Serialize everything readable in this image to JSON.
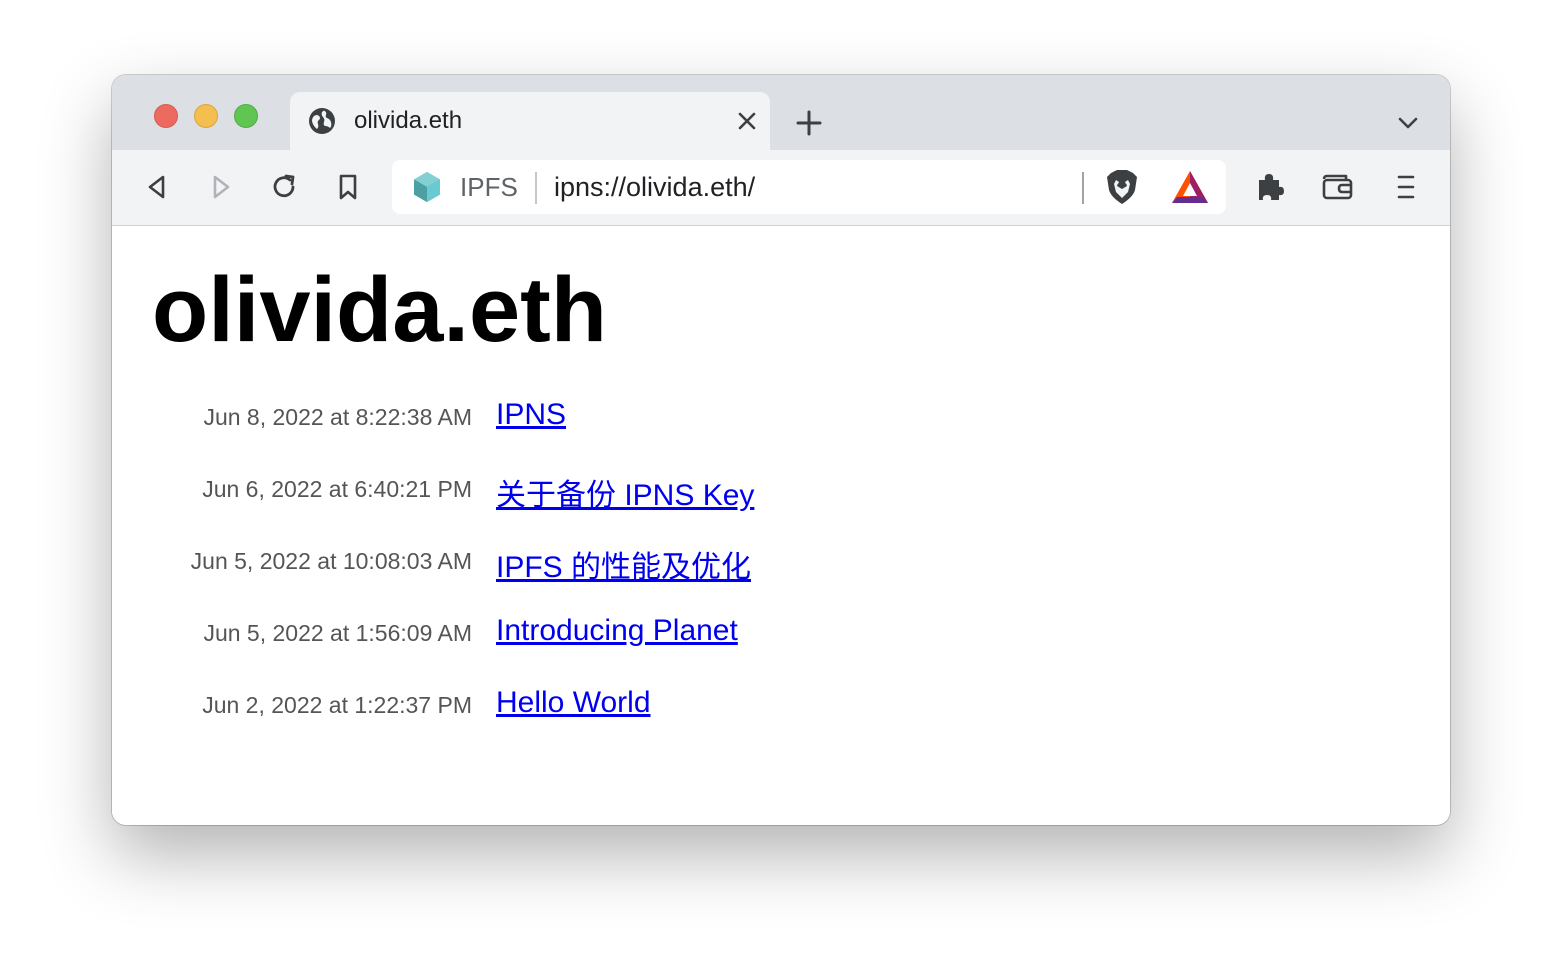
{
  "browser": {
    "tab": {
      "title": "olivida.eth",
      "icon": "globe-icon"
    },
    "address_bar": {
      "badge_label": "IPFS",
      "url": "ipns://olivida.eth/"
    },
    "icons": {
      "back": "back-arrow-icon",
      "forward": "forward-arrow-icon",
      "reload": "reload-icon",
      "bookmark": "bookmark-icon",
      "ipfs": "ipfs-cube-icon",
      "shields": "brave-shields-icon",
      "rewards": "brave-rewards-icon",
      "extensions": "puzzle-piece-icon",
      "wallet": "wallet-icon",
      "menu": "hamburger-menu-icon"
    }
  },
  "page": {
    "title": "olivida.eth",
    "posts": [
      {
        "date": "Jun 8, 2022 at 8:22:38 AM",
        "title": "IPNS"
      },
      {
        "date": "Jun 6, 2022 at 6:40:21 PM",
        "title": "关于备份 IPNS Key"
      },
      {
        "date": "Jun 5, 2022 at 10:08:03 AM",
        "title": "IPFS 的性能及优化"
      },
      {
        "date": "Jun 5, 2022 at 1:56:09 AM",
        "title": "Introducing Planet"
      },
      {
        "date": "Jun 2, 2022 at 1:22:37 PM",
        "title": "Hello World"
      }
    ]
  },
  "colors": {
    "link": "#0000ee",
    "date_text": "#555555",
    "titlebar": "#dcdfe3",
    "toolbar": "#f1f3f4"
  }
}
